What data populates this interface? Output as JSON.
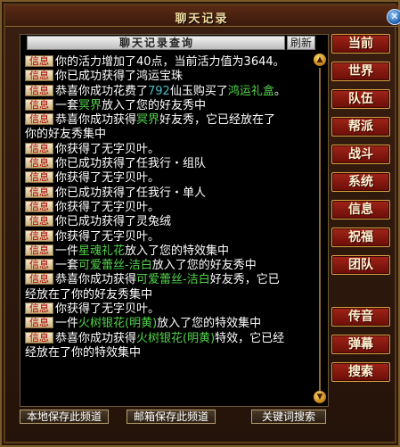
{
  "window": {
    "title": "聊天记录",
    "close_glyph": "✕"
  },
  "query": {
    "label": "聊天记录查询",
    "refresh_label": "刷新"
  },
  "messages": [
    {
      "tag": "信息",
      "parts": [
        {
          "t": "你的活力增加了40点，当前活力值为3644。",
          "c": "y"
        }
      ]
    },
    {
      "tag": "信息",
      "parts": [
        {
          "t": "你已成功获得了鸿运宝珠",
          "c": "y"
        }
      ]
    },
    {
      "tag": "信息",
      "parts": [
        {
          "t": "恭喜你成功花费了",
          "c": "y"
        },
        {
          "t": "792",
          "c": "c"
        },
        {
          "t": "仙玉购买了",
          "c": "y"
        },
        {
          "t": "鸿运礼盒",
          "c": "g"
        },
        {
          "t": "。",
          "c": "y"
        }
      ]
    },
    {
      "tag": "信息",
      "parts": [
        {
          "t": "一套",
          "c": "y"
        },
        {
          "t": "冥界",
          "c": "g"
        },
        {
          "t": "放入了您的好友秀中",
          "c": "y"
        }
      ]
    },
    {
      "tag": "信息",
      "parts": [
        {
          "t": "恭喜你成功获得",
          "c": "y"
        },
        {
          "t": "冥界",
          "c": "g"
        },
        {
          "t": "好友秀，它已经放在了",
          "c": "y"
        }
      ]
    },
    {
      "tag": "",
      "parts": [
        {
          "t": "你的好友秀集中",
          "c": "y"
        }
      ]
    },
    {
      "tag": "信息",
      "parts": [
        {
          "t": "你获得了无字贝叶。",
          "c": "y"
        }
      ]
    },
    {
      "tag": "信息",
      "parts": [
        {
          "t": "你已成功获得了任我行・组队",
          "c": "y"
        }
      ]
    },
    {
      "tag": "信息",
      "parts": [
        {
          "t": "你获得了无字贝叶。",
          "c": "y"
        }
      ]
    },
    {
      "tag": "信息",
      "parts": [
        {
          "t": "你已成功获得了任我行・单人",
          "c": "y"
        }
      ]
    },
    {
      "tag": "信息",
      "parts": [
        {
          "t": "你获得了无字贝叶。",
          "c": "y"
        }
      ]
    },
    {
      "tag": "信息",
      "parts": [
        {
          "t": "你已成功获得了灵兔绒",
          "c": "y"
        }
      ]
    },
    {
      "tag": "信息",
      "parts": [
        {
          "t": "你获得了无字贝叶。",
          "c": "y"
        }
      ]
    },
    {
      "tag": "信息",
      "parts": [
        {
          "t": "一件",
          "c": "y"
        },
        {
          "t": "星魂礼花",
          "c": "g"
        },
        {
          "t": "放入了您的特效集中",
          "c": "y"
        }
      ]
    },
    {
      "tag": "信息",
      "parts": [
        {
          "t": "一套",
          "c": "y"
        },
        {
          "t": "可爱蕾丝-洁白",
          "c": "g"
        },
        {
          "t": "放入了您的好友秀中",
          "c": "y"
        }
      ]
    },
    {
      "tag": "信息",
      "parts": [
        {
          "t": "恭喜你成功获得",
          "c": "y"
        },
        {
          "t": "可爱蕾丝-洁白",
          "c": "g"
        },
        {
          "t": "好友秀，它已",
          "c": "y"
        }
      ]
    },
    {
      "tag": "",
      "parts": [
        {
          "t": "经放在了你的好友秀集中",
          "c": "y"
        }
      ]
    },
    {
      "tag": "信息",
      "parts": [
        {
          "t": "你获得了无字贝叶。",
          "c": "y"
        }
      ]
    },
    {
      "tag": "信息",
      "parts": [
        {
          "t": "一件",
          "c": "y"
        },
        {
          "t": "火树银花(明黄)",
          "c": "g"
        },
        {
          "t": "放入了您的特效集中",
          "c": "y"
        }
      ]
    },
    {
      "tag": "信息",
      "parts": [
        {
          "t": "恭喜你成功获得",
          "c": "y"
        },
        {
          "t": "火树银花(明黄)",
          "c": "g"
        },
        {
          "t": "特效，它已经",
          "c": "y"
        }
      ]
    },
    {
      "tag": "",
      "parts": [
        {
          "t": "经放在了你的特效集中",
          "c": "y"
        }
      ]
    }
  ],
  "tabs": [
    "当前",
    "世界",
    "队伍",
    "帮派",
    "战斗",
    "系统",
    "信息",
    "祝福",
    "团队",
    "传音",
    "弹幕",
    "搜索"
  ],
  "bottom": {
    "save_local": "本地保存此频道",
    "save_mail": "邮箱保存此频道",
    "keyword_search": "关键词搜索"
  },
  "scroll": {
    "up_glyph": "▲",
    "down_glyph": "▼"
  }
}
